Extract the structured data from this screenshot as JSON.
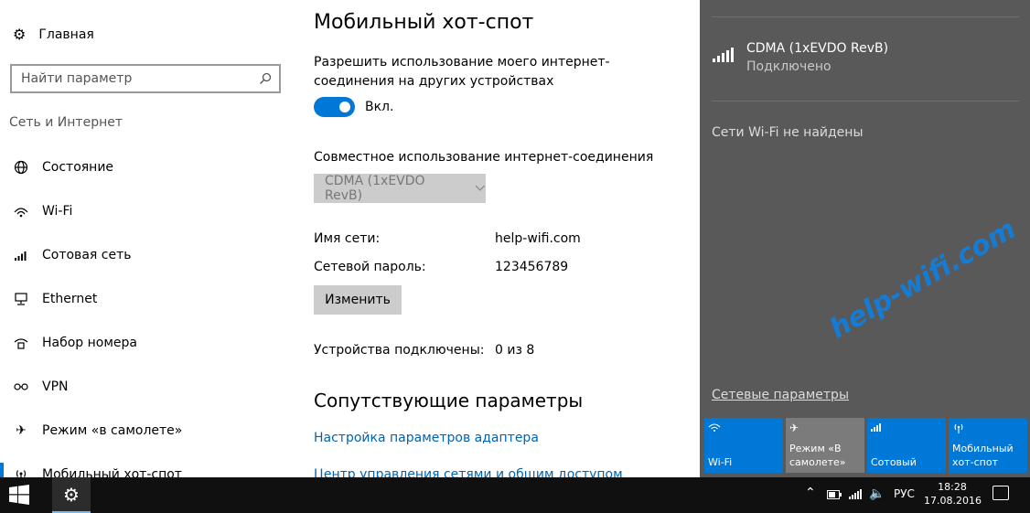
{
  "sidebar": {
    "home_label": "Главная",
    "search_placeholder": "Найти параметр",
    "section_title": "Сеть и Интернет",
    "items": [
      {
        "label": "Состояние",
        "icon": "globe-icon"
      },
      {
        "label": "Wi-Fi",
        "icon": "wifi-icon"
      },
      {
        "label": "Сотовая сеть",
        "icon": "cellular-icon"
      },
      {
        "label": "Ethernet",
        "icon": "ethernet-icon"
      },
      {
        "label": "Набор номера",
        "icon": "dialup-icon"
      },
      {
        "label": "VPN",
        "icon": "vpn-icon"
      },
      {
        "label": "Режим «в самолете»",
        "icon": "airplane-icon"
      },
      {
        "label": "Мобильный хот-спот",
        "icon": "hotspot-icon",
        "active": true
      }
    ]
  },
  "main": {
    "title": "Мобильный хот-спот",
    "share_description": "Разрешить использование моего интернет-соединения на других устройствах",
    "toggle_state": "Вкл.",
    "share_connection_label": "Совместное использование интернет-соединения",
    "share_connection_value": "CDMA (1xEVDO RevB)",
    "network_name_label": "Имя сети:",
    "network_name_value": "help-wifi.com",
    "password_label": "Сетевой пароль:",
    "password_value": "123456789",
    "edit_button": "Изменить",
    "devices_label": "Устройства подключены:",
    "devices_value": "0 из 8",
    "related_title": "Сопутствующие параметры",
    "links": [
      "Настройка параметров адаптера",
      "Центр управления сетями и общим доступом"
    ]
  },
  "action_center": {
    "network_name": "CDMA (1xEVDO RevB)",
    "network_status": "Подключено",
    "no_wifi": "Сети Wi-Fi не найдены",
    "network_settings": "Сетевые параметры",
    "tiles": [
      {
        "label": "Wi-Fi",
        "icon": "wifi-icon",
        "on": true
      },
      {
        "label": "Режим «В самолете»",
        "icon": "airplane-icon",
        "on": false
      },
      {
        "label": "Сотовый",
        "icon": "cellular-icon",
        "on": true
      },
      {
        "label": "Мобильный хот-спот",
        "icon": "hotspot-icon",
        "on": true
      }
    ],
    "watermark": "help-wifi.com"
  },
  "taskbar": {
    "language": "РУС",
    "time": "18:28",
    "date": "17.08.2016"
  },
  "colors": {
    "accent": "#0078d7",
    "link": "#0063b1",
    "action_center_bg": "#595959"
  }
}
